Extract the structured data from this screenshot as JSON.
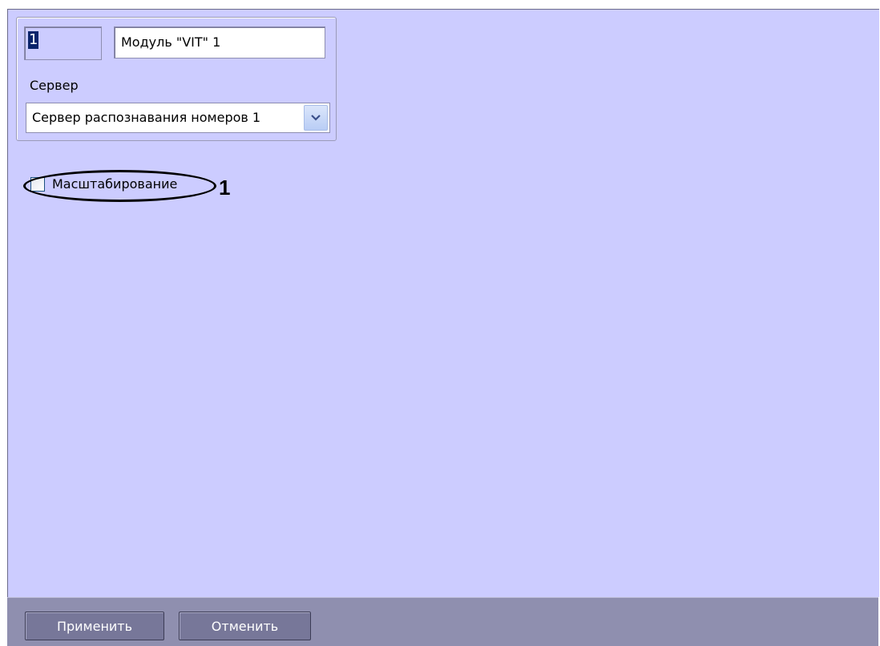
{
  "header": {
    "id_value": "1",
    "name_value": "Модуль \"VIT\" 1"
  },
  "server": {
    "label": "Сервер",
    "selected": "Сервер распознавания номеров 1"
  },
  "options": {
    "scaling_label": "Масштабирование",
    "scaling_checked": false
  },
  "callout": {
    "number": "1"
  },
  "footer": {
    "apply_label": "Применить",
    "cancel_label": "Отменить"
  },
  "icons": {
    "dropdown": "chevron-down-icon"
  },
  "colors": {
    "panel_bg": "#ccccff",
    "footer_bg": "#8f8faf",
    "button_bg": "#777799",
    "selection": "#0a246a"
  }
}
